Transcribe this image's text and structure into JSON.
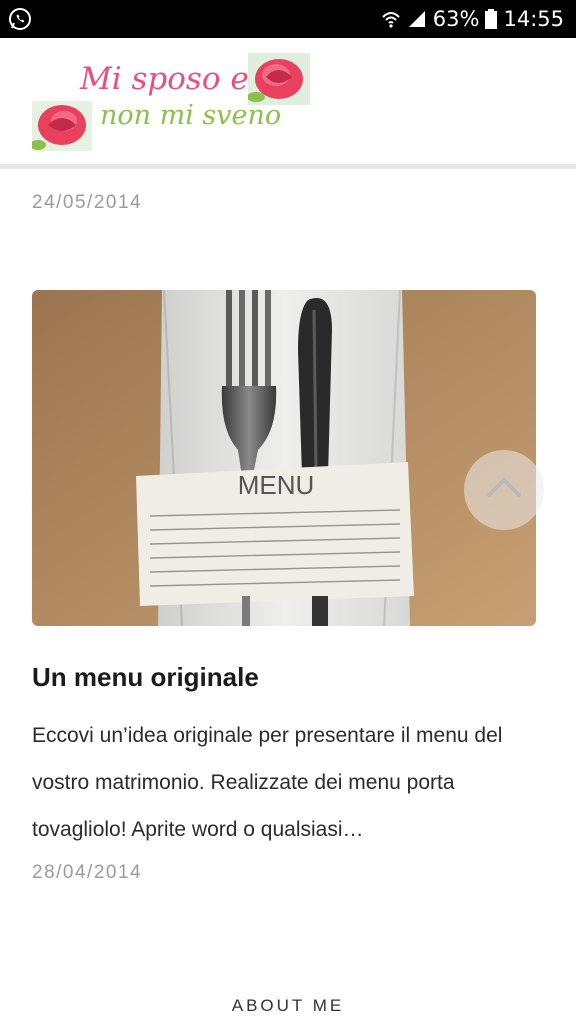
{
  "status_bar": {
    "left_icon": "whatsapp-icon",
    "battery_percent": "63%",
    "time": "14:55"
  },
  "header": {
    "logo_line1": "Mi sposo e",
    "logo_line2": "non mi sveno",
    "logo_colors": {
      "pink": "#e34f86",
      "green": "#8cc04a"
    }
  },
  "posts": [
    {
      "date": "24/05/2014"
    },
    {
      "image_menu_word": "MENU",
      "title": "Un menu originale",
      "excerpt": "Eccovi un’idea originale per presentare il menu del vostro matrimonio. Realizzate dei menu porta tovagliolo! Aprite word o qualsiasi…",
      "date": "28/04/2014"
    }
  ],
  "footer": {
    "about_label": "ABOUT ME"
  }
}
